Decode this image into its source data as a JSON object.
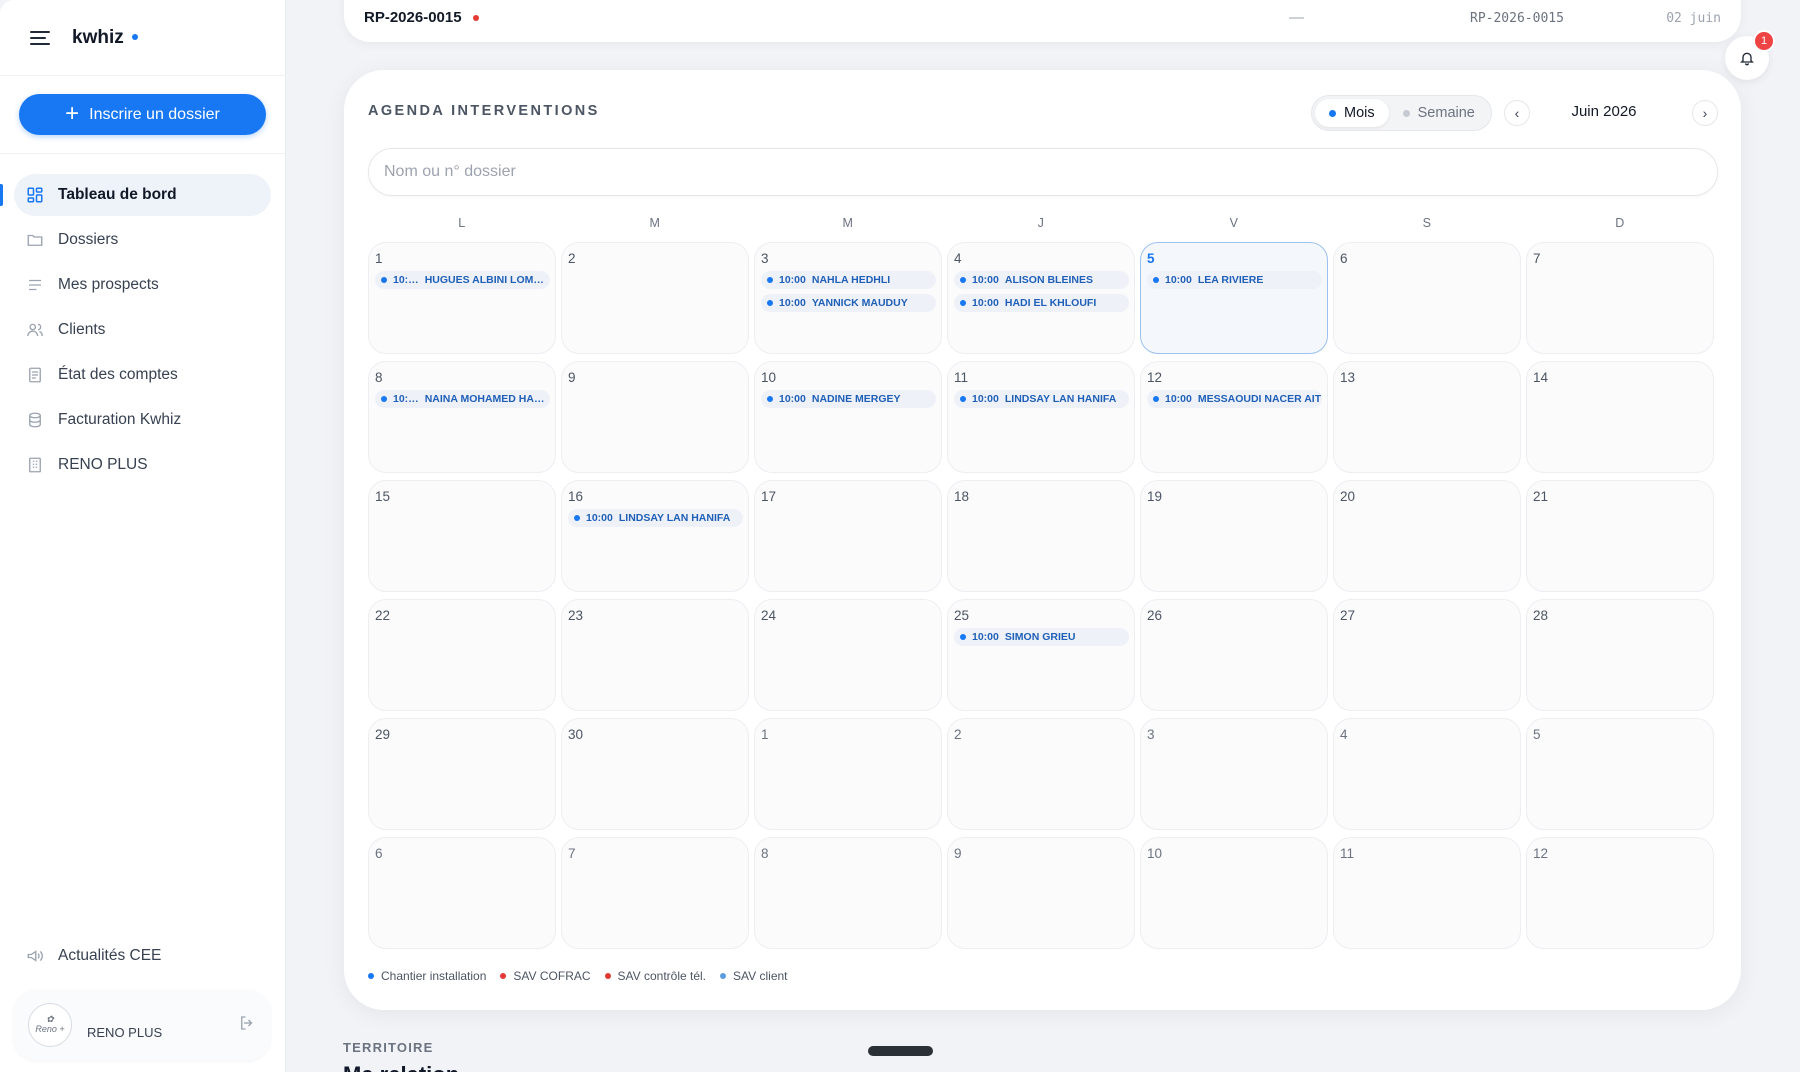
{
  "brand": {
    "name": "kwhiz"
  },
  "cta": {
    "label": "Inscrire un dossier"
  },
  "nav": [
    {
      "label": "Tableau de bord",
      "icon": "dashboard-icon",
      "active": true
    },
    {
      "label": "Dossiers",
      "icon": "folder-icon"
    },
    {
      "label": "Mes prospects",
      "icon": "list-icon"
    },
    {
      "label": "Clients",
      "icon": "users-icon"
    },
    {
      "label": "État des comptes",
      "icon": "document-icon"
    },
    {
      "label": "Facturation Kwhiz",
      "icon": "database-icon"
    },
    {
      "label": "RENO PLUS",
      "icon": "building-icon"
    }
  ],
  "news": {
    "label": "Actualités CEE",
    "icon": "megaphone-icon"
  },
  "account": {
    "name": "RENO PLUS",
    "avatar_text": "Reno +"
  },
  "topbar": {
    "ref": "RP-2026-0015",
    "dash": "—",
    "ref2": "RP-2026-0015",
    "date": "02 juin"
  },
  "notifications": {
    "count": "1"
  },
  "agenda": {
    "title": "AGENDA INTERVENTIONS",
    "view_month": "Mois",
    "view_week": "Semaine",
    "prev": "‹",
    "next": "›",
    "month_label": "Juin 2026",
    "search_placeholder": "Nom ou n° dossier",
    "weekdays": [
      "L",
      "M",
      "M",
      "J",
      "V",
      "S",
      "D"
    ],
    "weeks": [
      [
        {
          "d": "1",
          "ev": [
            {
              "t": "10:…",
              "n": "HUGUES ALBINI LOMA…"
            }
          ]
        },
        {
          "d": "2"
        },
        {
          "d": "3",
          "ev": [
            {
              "t": "10:00",
              "n": "NAHLA HEDHLI"
            },
            {
              "t": "10:00",
              "n": "YANNICK MAUDUY"
            }
          ]
        },
        {
          "d": "4",
          "ev": [
            {
              "t": "10:00",
              "n": "ALISON BLEINES"
            },
            {
              "t": "10:00",
              "n": "HADI EL KHLOUFI"
            }
          ]
        },
        {
          "d": "5",
          "today": true,
          "ev": [
            {
              "t": "10:00",
              "n": "LEA RIVIERE"
            }
          ]
        },
        {
          "d": "6"
        },
        {
          "d": "7"
        }
      ],
      [
        {
          "d": "8",
          "ev": [
            {
              "t": "10:…",
              "n": "NAINA MOHAMED HAN…"
            }
          ]
        },
        {
          "d": "9"
        },
        {
          "d": "10",
          "ev": [
            {
              "t": "10:00",
              "n": "NADINE MERGEY"
            }
          ]
        },
        {
          "d": "11",
          "ev": [
            {
              "t": "10:00",
              "n": "LINDSAY LAN HANIFA"
            }
          ]
        },
        {
          "d": "12",
          "ev": [
            {
              "t": "10:00",
              "n": "MESSAOUDI NACER AIT"
            }
          ]
        },
        {
          "d": "13"
        },
        {
          "d": "14"
        }
      ],
      [
        {
          "d": "15"
        },
        {
          "d": "16",
          "ev": [
            {
              "t": "10:00",
              "n": "LINDSAY LAN HANIFA"
            }
          ]
        },
        {
          "d": "17"
        },
        {
          "d": "18"
        },
        {
          "d": "19"
        },
        {
          "d": "20"
        },
        {
          "d": "21"
        }
      ],
      [
        {
          "d": "22"
        },
        {
          "d": "23"
        },
        {
          "d": "24"
        },
        {
          "d": "25",
          "ev": [
            {
              "t": "10:00",
              "n": "SIMON GRIEU"
            }
          ]
        },
        {
          "d": "26"
        },
        {
          "d": "27"
        },
        {
          "d": "28"
        }
      ],
      [
        {
          "d": "29"
        },
        {
          "d": "30"
        },
        {
          "d": "1",
          "out": true
        },
        {
          "d": "2",
          "out": true
        },
        {
          "d": "3",
          "out": true
        },
        {
          "d": "4",
          "out": true
        },
        {
          "d": "5",
          "out": true
        }
      ],
      [
        {
          "d": "6",
          "out": true
        },
        {
          "d": "7",
          "out": true
        },
        {
          "d": "8",
          "out": true
        },
        {
          "d": "9",
          "out": true
        },
        {
          "d": "10",
          "out": true
        },
        {
          "d": "11",
          "out": true
        },
        {
          "d": "12",
          "out": true
        }
      ]
    ],
    "legend": [
      {
        "label": "Chantier installation",
        "color": "#1877f2"
      },
      {
        "label": "SAV COFRAC",
        "color": "#e53935"
      },
      {
        "label": "SAV contrôle tél.",
        "color": "#e53935"
      },
      {
        "label": "SAV client",
        "color": "#5b9bdf"
      }
    ]
  },
  "section": {
    "label": "TERRITOIRE",
    "subtitle": "Ma relation"
  }
}
